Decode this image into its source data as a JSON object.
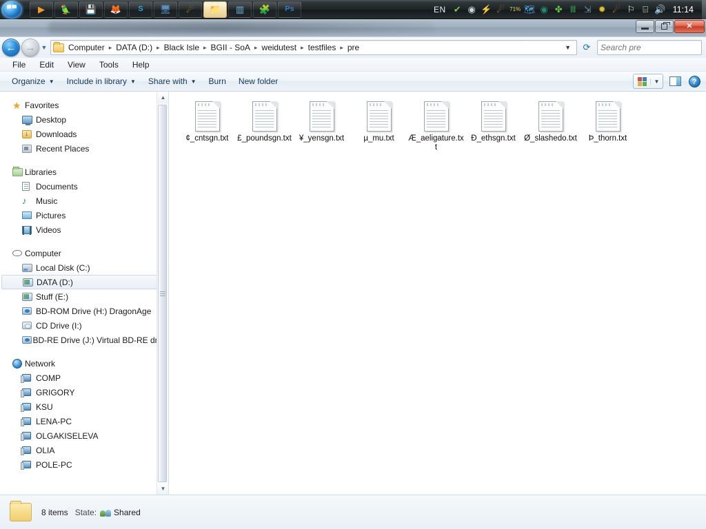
{
  "taskbar": {
    "start_label": "Start",
    "buttons": [
      {
        "name": "media-player-icon",
        "glyph": "▶",
        "color": "#f59a1e",
        "active": false
      },
      {
        "name": "parrot-app-icon",
        "glyph": "🦜",
        "color": "#d84b28",
        "active": false
      },
      {
        "name": "save-floppy-icon",
        "glyph": "💾",
        "color": "#e0e6ea",
        "active": false
      },
      {
        "name": "firefox-icon",
        "glyph": "🦊",
        "color": "#e8701a",
        "active": false
      },
      {
        "name": "skype-icon",
        "glyph": "S",
        "color": "#28a3e0",
        "active": false
      },
      {
        "name": "remote-desktop-icon",
        "glyph": "🖥",
        "color": "#5a8fbf",
        "active": false
      },
      {
        "name": "comet-app-icon",
        "glyph": "☄",
        "color": "#e09a2a",
        "active": false
      },
      {
        "name": "explorer-icon",
        "glyph": "📁",
        "color": "#e0b84a",
        "active": true
      },
      {
        "name": "window-app-icon",
        "glyph": "▥",
        "color": "#6fb4dc",
        "active": false
      },
      {
        "name": "puzzle-app-icon",
        "glyph": "🧩",
        "color": "#d8c a2a",
        "active": false
      },
      {
        "name": "photoshop-icon",
        "glyph": "Ps",
        "color": "#2a7fc4",
        "active": false
      }
    ],
    "language": "EN",
    "tray": [
      {
        "name": "shield-check-tray-icon",
        "glyph": "✔",
        "color": "#7ac943"
      },
      {
        "name": "clock-tray-icon",
        "glyph": "◉",
        "color": "#cfd6db"
      },
      {
        "name": "flash-tray-icon",
        "glyph": "⚡",
        "color": "#2a7fd4"
      },
      {
        "name": "comet-tray-icon",
        "glyph": "☄",
        "color": "#e09a2a"
      },
      {
        "name": "battery-tray-icon",
        "glyph": "71%",
        "color": "#e8d84a"
      },
      {
        "name": "map-tray-icon",
        "glyph": "🗺",
        "color": "#4fa0d8"
      },
      {
        "name": "disc-tray-icon",
        "glyph": "◉",
        "color": "#1f8f6f"
      },
      {
        "name": "clover-tray-icon",
        "glyph": "✤",
        "color": "#5fc23f"
      },
      {
        "name": "monitor-tray-icon",
        "glyph": "Ⅲ",
        "color": "#2f9f4f"
      },
      {
        "name": "usb-tray-icon",
        "glyph": "⇲",
        "color": "#6f8fa8"
      },
      {
        "name": "bee-tray-icon",
        "glyph": "✹",
        "color": "#e0c02a"
      },
      {
        "name": "comet2-tray-icon",
        "glyph": "☄",
        "color": "#e09a2a"
      },
      {
        "name": "flag-tray-icon",
        "glyph": "⚐",
        "color": "#e8eef2"
      },
      {
        "name": "network-tray-icon",
        "glyph": "⌸",
        "color": "#dde4e8"
      },
      {
        "name": "volume-tray-icon",
        "glyph": "🔊",
        "color": "#eef3f6"
      }
    ],
    "clock": "11:14"
  },
  "window": {
    "title": "",
    "controls": {
      "minimize": "Minimize",
      "restore": "Restore",
      "close": "Close"
    }
  },
  "address": {
    "back_label": "Back",
    "forward_label": "Forward",
    "history_label": "Recent pages",
    "breadcrumb": [
      "Computer",
      "DATA (D:)",
      "Black Isle",
      "BGII - SoA",
      "weidutest",
      "testfiles",
      "pre"
    ],
    "separator": "▸",
    "refresh_label": "Refresh",
    "search_placeholder": "Search pre",
    "search_value": ""
  },
  "menubar": {
    "items": [
      "File",
      "Edit",
      "View",
      "Tools",
      "Help"
    ]
  },
  "toolbar": {
    "commands": [
      {
        "label": "Organize",
        "caret": true
      },
      {
        "label": "Include in library",
        "caret": true
      },
      {
        "label": "Share with",
        "caret": true
      },
      {
        "label": "Burn",
        "caret": false
      },
      {
        "label": "New folder",
        "caret": false
      }
    ],
    "view_label": "Change your view",
    "preview_label": "Show the preview pane",
    "help_label": "Get help",
    "help_glyph": "?"
  },
  "navpane": {
    "groups": [
      {
        "header": {
          "label": "Favorites",
          "icon": "star-icon"
        },
        "items": [
          {
            "label": "Desktop",
            "icon": "desktop-icon"
          },
          {
            "label": "Downloads",
            "icon": "downloads-icon"
          },
          {
            "label": "Recent Places",
            "icon": "recent-places-icon"
          }
        ]
      },
      {
        "header": {
          "label": "Libraries",
          "icon": "libraries-icon"
        },
        "items": [
          {
            "label": "Documents",
            "icon": "documents-icon"
          },
          {
            "label": "Music",
            "icon": "music-icon"
          },
          {
            "label": "Pictures",
            "icon": "pictures-icon"
          },
          {
            "label": "Videos",
            "icon": "videos-icon"
          }
        ]
      },
      {
        "header": {
          "label": "Computer",
          "icon": "computer-icon"
        },
        "items": [
          {
            "label": "Local Disk (C:)",
            "icon": "hard-disk-icon"
          },
          {
            "label": "DATA (D:)",
            "icon": "drive-icon",
            "selected": true
          },
          {
            "label": "Stuff (E:)",
            "icon": "drive-icon"
          },
          {
            "label": "BD-ROM Drive (H:) DragonAge",
            "icon": "bd-rom-icon"
          },
          {
            "label": "CD Drive (I:)",
            "icon": "cd-drive-icon"
          },
          {
            "label": "BD-RE Drive (J:) Virtual BD-RE drive",
            "icon": "bd-re-icon"
          }
        ]
      },
      {
        "header": {
          "label": "Network",
          "icon": "network-icon"
        },
        "items": [
          {
            "label": "COMP",
            "icon": "computer-node-icon"
          },
          {
            "label": "GRIGORY",
            "icon": "computer-node-icon"
          },
          {
            "label": "KSU",
            "icon": "computer-node-icon"
          },
          {
            "label": "LENA-PC",
            "icon": "computer-node-icon"
          },
          {
            "label": "OLGAKISELEVA",
            "icon": "computer-node-icon"
          },
          {
            "label": "OLIA",
            "icon": "computer-node-icon"
          },
          {
            "label": "POLE-PC",
            "icon": "computer-node-icon"
          }
        ]
      }
    ]
  },
  "files": [
    {
      "name": "¢_cntsgn.txt",
      "icon": "text-file-icon"
    },
    {
      "name": "£_poundsgn.txt",
      "icon": "text-file-icon"
    },
    {
      "name": "¥_yensgn.txt",
      "icon": "text-file-icon"
    },
    {
      "name": "µ_mu.txt",
      "icon": "text-file-icon"
    },
    {
      "name": "Æ_aeligature.txt",
      "icon": "text-file-icon"
    },
    {
      "name": "Ð_ethsgn.txt",
      "icon": "text-file-icon"
    },
    {
      "name": "Ø_slashedo.txt",
      "icon": "text-file-icon"
    },
    {
      "name": "Þ_thorn.txt",
      "icon": "text-file-icon"
    }
  ],
  "statusbar": {
    "item_count": "8 items",
    "state_label": "State:",
    "state_value": "Shared"
  },
  "colors": {
    "accent": "#2a7fc4",
    "close_button": "#c73d22",
    "selection": "#e8eff6",
    "taskbar": "#1d2325"
  }
}
